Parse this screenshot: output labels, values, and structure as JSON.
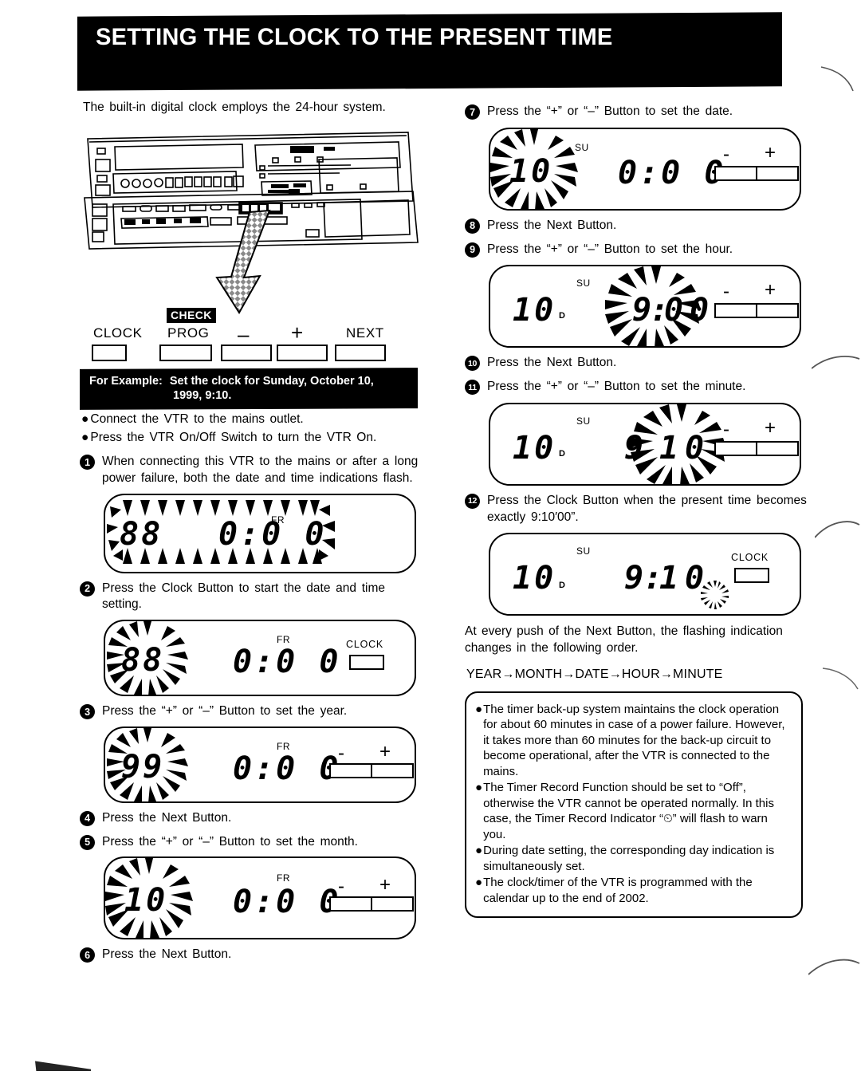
{
  "header": {
    "title": "SETTING THE CLOCK TO THE PRESENT TIME"
  },
  "intro": "The built-in digital clock employs the 24-hour system.",
  "vcr_panel": {
    "buttons": [
      {
        "label": "CLOCK",
        "tag": ""
      },
      {
        "label": "PROG",
        "tag": "CHECK"
      },
      {
        "label": "–",
        "tag": ""
      },
      {
        "label": "+",
        "tag": ""
      },
      {
        "label": "NEXT",
        "tag": ""
      }
    ]
  },
  "example": {
    "label": "For Example:",
    "line1": "Set the clock for Sunday, October 10,",
    "line2": "1999, 9:10."
  },
  "prep_bullets": [
    "Connect the VTR to the mains outlet.",
    "Press the VTR On/Off Switch to turn the VTR On."
  ],
  "steps": [
    {
      "num": "1",
      "text": "When connecting this VTR to the mains or after a long power failure, both the date and time indications flash."
    },
    {
      "num": "2",
      "text": "Press the Clock Button to start the date and time setting."
    },
    {
      "num": "3",
      "text": "Press the “+” or “–” Button to set the year."
    },
    {
      "num": "4",
      "text": "Press the Next Button."
    },
    {
      "num": "5",
      "text": "Press the “+” or “–” Button to set the month."
    },
    {
      "num": "6",
      "text": "Press the Next Button."
    },
    {
      "num": "7",
      "text": "Press the “+” or “–” Button to set the date."
    },
    {
      "num": "8",
      "text": "Press the Next Button."
    },
    {
      "num": "9",
      "text": "Press the “+” or “–” Button to set the hour."
    },
    {
      "num": "10",
      "text": "Press the Next Button."
    },
    {
      "num": "11",
      "text": "Press the “+” or “–” Button to set the minute."
    },
    {
      "num": "12",
      "text": "Press the Clock Button when the present time becomes exactly 9:10′00”."
    }
  ],
  "displays": {
    "d1": {
      "date": "88",
      "time": "0:0 0",
      "weekday": "FR",
      "flash": "all",
      "keys": []
    },
    "d2": {
      "date": "88",
      "time": "0:0 0",
      "weekday": "FR",
      "flash": "date",
      "keys": [
        "CLOCK"
      ]
    },
    "d3": {
      "date": "99",
      "time": "0:0 0",
      "weekday": "FR",
      "flash": "date",
      "keys": [
        "-",
        "+"
      ]
    },
    "d4": {
      "date": "10",
      "time": "0:0 0",
      "weekday": "FR",
      "flash": "date",
      "keys": [
        "-",
        "+"
      ]
    },
    "d5": {
      "date": "10",
      "time": "0:0 0",
      "weekday": "SU",
      "flash": "date",
      "keys": [
        "-",
        "+"
      ]
    },
    "d6": {
      "date": "10",
      "day_index": "D",
      "time_h": "9",
      "time_m1": "0",
      "time_m2": "0",
      "weekday": "SU",
      "flash": "hour",
      "keys": [
        "-",
        "+"
      ]
    },
    "d7": {
      "date": "10",
      "day_index": "D",
      "time_h": "9",
      "time_m1": "1",
      "time_m2": "0",
      "weekday": "SU",
      "flash": "minute",
      "keys": [
        "-",
        "+"
      ]
    },
    "d8": {
      "date": "10",
      "day_index": "D",
      "time_h": "9",
      "time_m1": "1",
      "time_m2": "0",
      "weekday": "SU",
      "flash": "seconds",
      "keys": [
        "CLOCK"
      ]
    }
  },
  "order_note": {
    "paragraph": "At every push of the Next Button, the flashing indication changes in the following order.",
    "sequence": "YEAR→MONTH→DATE→HOUR→MINUTE"
  },
  "notes": [
    "The timer back-up system maintains the clock operation for about 60 minutes in case of a power failure. However, it takes more than 60 minutes for the back-up circuit to become operational, after the VTR is connected to the mains.",
    "The Timer Record Function should be set to “Off”, otherwise the VTR cannot be operated normally. In this case, the Timer Record Indicator “⏲” will flash to warn you.",
    "During date setting, the corresponding day indication is simultaneously set.",
    "The clock/timer of the VTR is programmed with the calendar up to the end of 2002."
  ]
}
